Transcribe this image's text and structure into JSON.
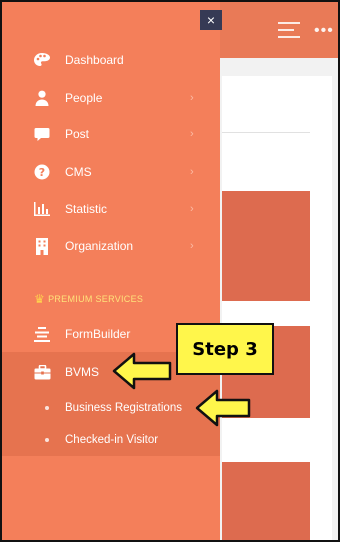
{
  "colors": {
    "sidebar_bg": "#f47f5a",
    "active_group_bg": "#e6734f",
    "topbar_bg": "#e97a57",
    "premium_label": "#ffe27a",
    "callout_bg": "#fff64b",
    "close_button_bg": "#363a55"
  },
  "header": {
    "close_icon": "×",
    "more_icon": "•••"
  },
  "sidebar": {
    "items": [
      {
        "label": "Dashboard",
        "icon": "palette-icon",
        "glyph": "🎨"
      },
      {
        "label": "People",
        "icon": "person-icon",
        "glyph": "",
        "chevron": "›"
      },
      {
        "label": "Post",
        "icon": "speech-bubble-icon",
        "glyph": "",
        "chevron": "›"
      },
      {
        "label": "CMS",
        "icon": "question-circle-icon",
        "glyph": "?",
        "chevron": "›"
      },
      {
        "label": "Statistic",
        "icon": "bar-chart-icon",
        "glyph": "",
        "chevron": "›"
      },
      {
        "label": "Organization",
        "icon": "building-icon",
        "glyph": "",
        "chevron": "›"
      }
    ],
    "section_label": "PREMIUM SERVICES",
    "premium_items": [
      {
        "label": "FormBuilder",
        "icon": "formbuilder-icon"
      },
      {
        "label": "BVMS",
        "icon": "briefcase-icon"
      }
    ],
    "bvms_subitems": [
      {
        "label": "Business Registrations"
      },
      {
        "label": "Checked-in Visitor"
      }
    ]
  },
  "annotation": {
    "callout_text": "Step 3"
  }
}
